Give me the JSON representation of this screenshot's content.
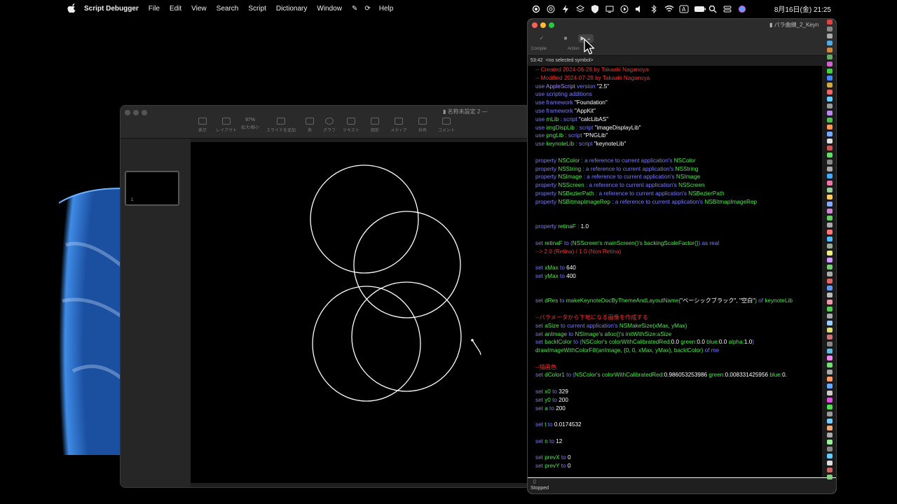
{
  "menubar": {
    "app_name": "Script Debugger",
    "items": [
      "File",
      "Edit",
      "View",
      "Search",
      "Script",
      "Dictionary",
      "Window",
      "Help"
    ],
    "clock": "8月16日(金)  21:25"
  },
  "keynote": {
    "title": "名称未設定 2 —",
    "toolbar": [
      "表示",
      "レイアウト",
      "拡大/縮小",
      "スライドを追加",
      "表",
      "グラフ",
      "テキスト",
      "図形",
      "メディア",
      "共有",
      "コメント"
    ],
    "zoom": "97%",
    "slide_number": "1"
  },
  "script_debugger": {
    "title": "パラ曲線_2_Keyn",
    "toolbar": {
      "compile_label": "Compile",
      "action_label": "Action"
    },
    "position": "53:42",
    "symbol": "<no selected symbol>",
    "status": "Stopped",
    "code_lines": [
      [
        [
          "c-com",
          "-- Created 2024-06-28 by Takaaki Naganoya"
        ]
      ],
      [
        [
          "c-com",
          "-- Modified 2024-07-28 by Takaaki Naganoya"
        ]
      ],
      [
        [
          "c-kw",
          "use "
        ],
        [
          "c-app",
          "AppleScript"
        ],
        [
          "c-kw",
          " version "
        ],
        [
          "c-str",
          "\"2.5\""
        ]
      ],
      [
        [
          "c-kw",
          "use scripting additions"
        ]
      ],
      [
        [
          "c-kw",
          "use framework "
        ],
        [
          "c-str",
          "\"Foundation\""
        ]
      ],
      [
        [
          "c-kw",
          "use framework "
        ],
        [
          "c-str",
          "\"AppKit\""
        ]
      ],
      [
        [
          "c-kw",
          "use "
        ],
        [
          "c-var",
          "mLib"
        ],
        [
          "c-kw",
          " : script "
        ],
        [
          "c-str",
          "\"calcLibAS\""
        ]
      ],
      [
        [
          "c-kw",
          "use "
        ],
        [
          "c-var",
          "imgDispLib"
        ],
        [
          "c-kw",
          " : script "
        ],
        [
          "c-str",
          "\"imageDisplayLib\""
        ]
      ],
      [
        [
          "c-kw",
          "use "
        ],
        [
          "c-var",
          "pngLib"
        ],
        [
          "c-kw",
          " : script "
        ],
        [
          "c-str",
          "\"PNGLib\""
        ]
      ],
      [
        [
          "c-kw",
          "use "
        ],
        [
          "c-var",
          "keynoteLib"
        ],
        [
          "c-kw",
          " : script "
        ],
        [
          "c-str",
          "\"keynoteLib\""
        ]
      ],
      [],
      [
        [
          "c-kw",
          "property "
        ],
        [
          "c-var",
          "NSColor"
        ],
        [
          "c-kw",
          " : a reference to current application's "
        ],
        [
          "c-var",
          "NSColor"
        ]
      ],
      [
        [
          "c-kw",
          "property "
        ],
        [
          "c-var",
          "NSString"
        ],
        [
          "c-kw",
          " : a reference to current application's "
        ],
        [
          "c-var",
          "NSString"
        ]
      ],
      [
        [
          "c-kw",
          "property "
        ],
        [
          "c-var",
          "NSImage"
        ],
        [
          "c-kw",
          " : a reference to current application's "
        ],
        [
          "c-var",
          "NSImage"
        ]
      ],
      [
        [
          "c-kw",
          "property "
        ],
        [
          "c-var",
          "NSScreen"
        ],
        [
          "c-kw",
          " : a reference to current application's "
        ],
        [
          "c-var",
          "NSScreen"
        ]
      ],
      [
        [
          "c-kw",
          "property "
        ],
        [
          "c-var",
          "NSBezierPath"
        ],
        [
          "c-kw",
          " : a reference to current application's "
        ],
        [
          "c-var",
          "NSBezierPath"
        ]
      ],
      [
        [
          "c-kw",
          "property "
        ],
        [
          "c-var",
          "NSBitmapImageRep"
        ],
        [
          "c-kw",
          " : a reference to current application's "
        ],
        [
          "c-var",
          "NSBitmapImageRep"
        ]
      ],
      [],
      [],
      [
        [
          "c-kw",
          "property "
        ],
        [
          "c-var",
          "retinaF"
        ],
        [
          "c-kw",
          " : "
        ],
        [
          "c-str",
          "1.0"
        ]
      ],
      [],
      [
        [
          "c-kw",
          "set "
        ],
        [
          "c-var",
          "retinaF"
        ],
        [
          "c-kw",
          " to ("
        ],
        [
          "c-var",
          "NSScreen's mainScreen()'s backingScaleFactor()"
        ],
        [
          "c-kw",
          ") as real"
        ]
      ],
      [
        [
          "c-com",
          "--> 2.0 (Retina) / 1.0 (Non Retina)"
        ]
      ],
      [],
      [
        [
          "c-kw",
          "set "
        ],
        [
          "c-var",
          "xMax"
        ],
        [
          "c-kw",
          " to "
        ],
        [
          "c-str",
          "640"
        ]
      ],
      [
        [
          "c-kw",
          "set "
        ],
        [
          "c-var",
          "yMax"
        ],
        [
          "c-kw",
          " to "
        ],
        [
          "c-str",
          "400"
        ]
      ],
      [],
      [],
      [
        [
          "c-kw",
          "set "
        ],
        [
          "c-var",
          "dRes"
        ],
        [
          "c-kw",
          " to "
        ],
        [
          "c-var",
          "makeKeynoteDocByThemeAndLayoutName("
        ],
        [
          "c-str",
          "\"ベーシックブラック\", \"空白\""
        ],
        [
          "c-var",
          ")"
        ],
        [
          "c-kw",
          " of "
        ],
        [
          "c-var",
          "keynoteLib"
        ]
      ],
      [],
      [
        [
          "c-com",
          "--パラメータから下地になる画像を作成する"
        ]
      ],
      [
        [
          "c-kw",
          "set "
        ],
        [
          "c-var",
          "aSize"
        ],
        [
          "c-kw",
          " to current application's "
        ],
        [
          "c-var",
          "NSMakeSize(xMax, yMax)"
        ]
      ],
      [
        [
          "c-kw",
          "set "
        ],
        [
          "c-var",
          "anImage"
        ],
        [
          "c-kw",
          " to "
        ],
        [
          "c-var",
          "NSImage's alloc()'s initWithSize:aSize"
        ]
      ],
      [
        [
          "c-kw",
          "set "
        ],
        [
          "c-var",
          "backlColor"
        ],
        [
          "c-kw",
          " to ("
        ],
        [
          "c-var",
          "NSColor's colorWithCalibratedRed:"
        ],
        [
          "c-str",
          "0.0"
        ],
        [
          "c-var",
          " green:"
        ],
        [
          "c-str",
          "0.0"
        ],
        [
          "c-var",
          " blue:"
        ],
        [
          "c-str",
          "0.0"
        ],
        [
          "c-var",
          " alpha:"
        ],
        [
          "c-str",
          "1.0"
        ],
        [
          "c-kw",
          ")"
        ]
      ],
      [
        [
          "c-var",
          "drawImageWithColorFill(anImage, {0, 0, xMax, yMax}, backlColor)"
        ],
        [
          "c-kw",
          " of me"
        ]
      ],
      [],
      [
        [
          "c-com",
          "--描画色"
        ]
      ],
      [
        [
          "c-kw",
          "set "
        ],
        [
          "c-var",
          "dColor1"
        ],
        [
          "c-kw",
          " to ("
        ],
        [
          "c-var",
          "NSColor's colorWithCalibratedRed:"
        ],
        [
          "c-str",
          "0.986053253986"
        ],
        [
          "c-var",
          " green:"
        ],
        [
          "c-str",
          "0.008331425956"
        ],
        [
          "c-var",
          " blue:"
        ],
        [
          "c-str",
          "0."
        ]
      ],
      [],
      [
        [
          "c-kw",
          "set "
        ],
        [
          "c-var",
          "x0"
        ],
        [
          "c-kw",
          " to "
        ],
        [
          "c-str",
          "329"
        ]
      ],
      [
        [
          "c-kw",
          "set "
        ],
        [
          "c-var",
          "y0"
        ],
        [
          "c-kw",
          " to "
        ],
        [
          "c-str",
          "200"
        ]
      ],
      [
        [
          "c-kw",
          "set "
        ],
        [
          "c-var",
          "a"
        ],
        [
          "c-kw",
          " to "
        ],
        [
          "c-str",
          "200"
        ]
      ],
      [],
      [
        [
          "c-kw",
          "set "
        ],
        [
          "c-var",
          "t"
        ],
        [
          "c-kw",
          " to "
        ],
        [
          "c-str",
          "0.0174532"
        ]
      ],
      [],
      [
        [
          "c-kw",
          "set "
        ],
        [
          "c-var",
          "n"
        ],
        [
          "c-kw",
          " to "
        ],
        [
          "c-str",
          "12"
        ]
      ],
      [],
      [
        [
          "c-kw",
          "set "
        ],
        [
          "c-var",
          "prevX"
        ],
        [
          "c-kw",
          " to "
        ],
        [
          "c-str",
          "0"
        ]
      ],
      [
        [
          "c-kw",
          "set "
        ],
        [
          "c-var",
          "prevY"
        ],
        [
          "c-kw",
          " to "
        ],
        [
          "c-str",
          "0"
        ]
      ]
    ]
  },
  "colors": {
    "comment": "#ee3333",
    "keyword": "#7b7bff",
    "variable": "#4ce84c",
    "accent": "#ffffff"
  },
  "icons": [
    "apple-icon",
    "record-icon",
    "cast-icon",
    "bolt-icon",
    "layers-icon",
    "shield-icon",
    "display-icon",
    "play-icon",
    "volume-icon",
    "bluetooth-icon",
    "wifi-icon",
    "keyboard-icon",
    "battery-icon",
    "search-icon",
    "control-center-icon",
    "siri-icon"
  ]
}
